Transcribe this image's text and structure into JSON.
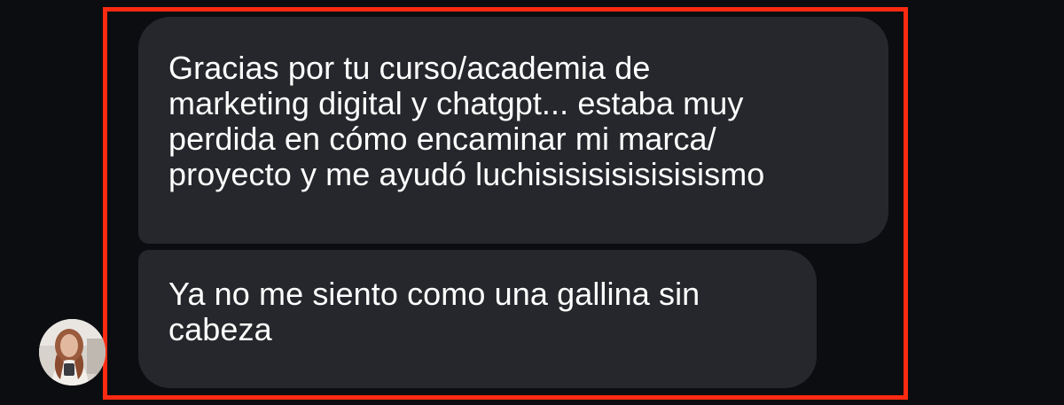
{
  "conversation": {
    "messages": [
      {
        "text": "Gracias por tu curso/academia de\nmarketing digital y chatgpt... estaba muy\nperdida en cómo encaminar mi marca/\nproyecto y me ayudó luchisisisisisisisismo"
      },
      {
        "text": "Ya no me siento como una gallina sin\ncabeza"
      }
    ],
    "sender": {
      "avatar_icon": "user-avatar-photo"
    }
  },
  "colors": {
    "background": "#0b0d10",
    "bubble": "#26272c",
    "highlight": "#ff2a12",
    "text": "#ffffff"
  }
}
